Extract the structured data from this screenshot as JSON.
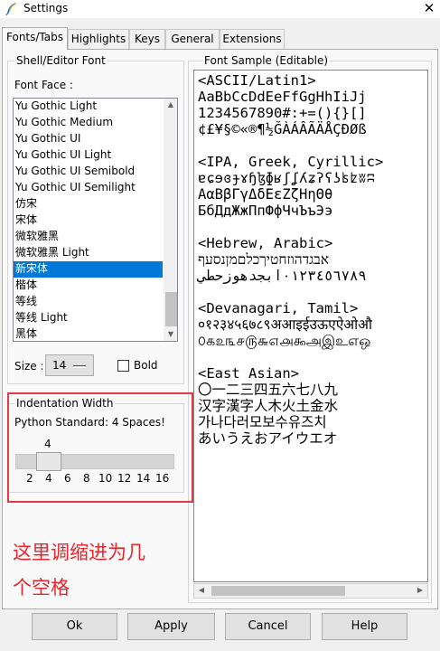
{
  "window": {
    "title": "Settings",
    "close_glyph": "✕",
    "icon": "feather-icon"
  },
  "tabs": [
    {
      "label": "Fonts/Tabs",
      "active": true
    },
    {
      "label": "Highlights",
      "active": false
    },
    {
      "label": "Keys",
      "active": false
    },
    {
      "label": "General",
      "active": false
    },
    {
      "label": "Extensions",
      "active": false
    }
  ],
  "font_group": {
    "title": "Shell/Editor Font",
    "face_label": "Font Face :",
    "fonts": [
      "Yu Gothic Light",
      "Yu Gothic Medium",
      "Yu Gothic UI",
      "Yu Gothic UI Light",
      "Yu Gothic UI Semibold",
      "Yu Gothic UI Semilight",
      "仿宋",
      "宋体",
      "微软雅黑",
      "微软雅黑 Light",
      "新宋体",
      "楷体",
      "等线",
      "等线 Light",
      "黑体"
    ],
    "selected_index": 10,
    "size_label": "Size :",
    "size_value": "14",
    "bold_label": "Bold",
    "bold_checked": false
  },
  "indent_group": {
    "title": "Indentation Width",
    "standard_text": "Python Standard: 4 Spaces!",
    "current_value": "4",
    "ticks": [
      "2",
      "4",
      "6",
      "8",
      "10",
      "12",
      "14",
      "16"
    ]
  },
  "sample": {
    "title": "Font Sample (Editable)",
    "text": "<ASCII/Latin1>\nAaBbCcDdEeFfGgHhIiJj\n1234567890#:+=(){}[]\n¢£¥§©«®¶½ĞÀÁÂÃÄÅÇÐØß\n\n<IPA, Greek, Cyrillic>\nɐɕɘɞɟɤɧɮɸʁʃʆʎʑʔʕʖʪʫʬʭ\nΑαΒβΓγΔδΕεΖζΗηΘθ\nБбДдЖжПпФфЧчЪъЭэ\n\n<Hebrew, Arabic>\nאבגדהוזחטיךכלםמןנסעף\n٠١٢٣٤٥٦٧٨٩ابجدهوزحطي\n\n<Devanagari, Tamil>\n०१२३४५६७८९अआइईउऊएऐओऔ\n௦௧௨௩௪௫௬௭௮௯அஇஉஎஒ\n\n<East Asian>\n〇一二三四五六七八九\n汉字漢字人木火土金水\n가나다러모보수유즈치\nあいうえおアイウエオ"
  },
  "annotation": {
    "line1": "这里调缩进为几",
    "line2": "个空格",
    "color": "#e8262d"
  },
  "buttons": {
    "ok": "Ok",
    "apply": "Apply",
    "cancel": "Cancel",
    "help": "Help"
  }
}
